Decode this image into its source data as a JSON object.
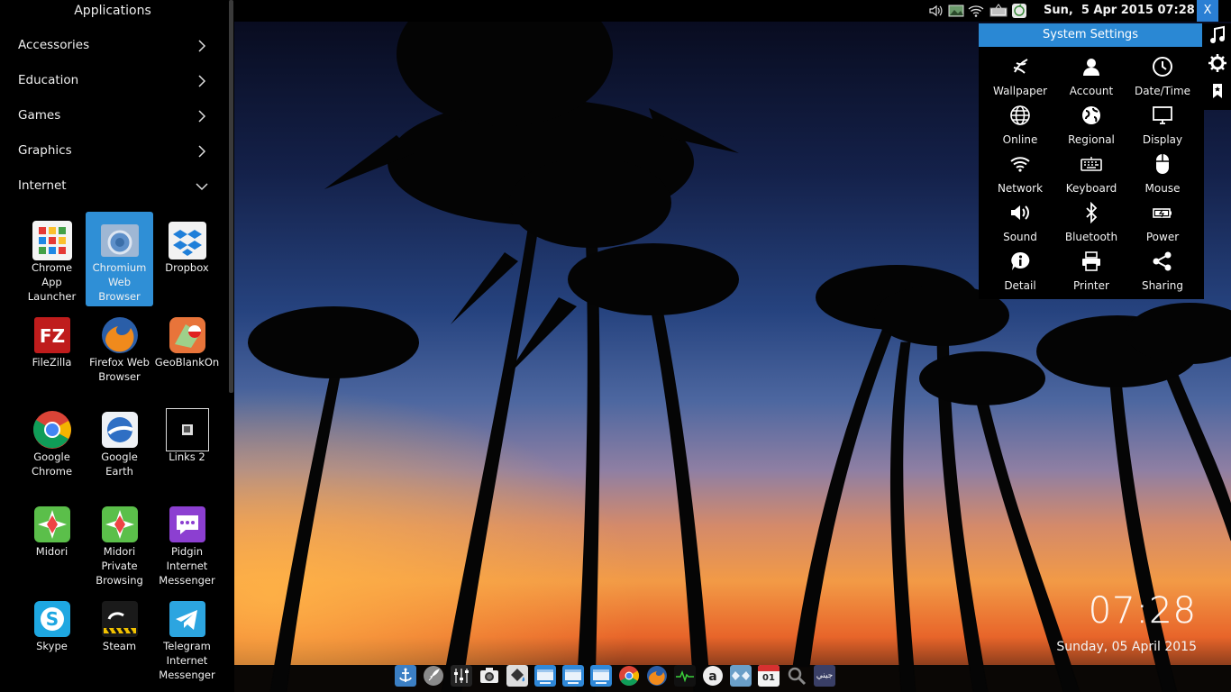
{
  "topbar": {
    "datetime": "Sun,  5 Apr 2015 07:28",
    "close_label": "X",
    "tray_icons": [
      "volume-icon",
      "image-viewer-icon",
      "wifi-icon",
      "keyboard-icon",
      "update-icon"
    ]
  },
  "appmenu": {
    "title": "Applications",
    "categories": [
      {
        "label": "Accessories",
        "expanded": false
      },
      {
        "label": "Education",
        "expanded": false
      },
      {
        "label": "Games",
        "expanded": false
      },
      {
        "label": "Graphics",
        "expanded": false
      },
      {
        "label": "Internet",
        "expanded": true
      }
    ],
    "apps": [
      {
        "label": "Chrome App Launcher",
        "lines": [
          "Chrome",
          "App",
          "Launcher"
        ],
        "icon": "chrome-app-launcher-icon",
        "selected": false
      },
      {
        "label": "Chromium Web Browser",
        "lines": [
          "Chromium",
          "Web",
          "Browser"
        ],
        "icon": "chromium-icon",
        "selected": true
      },
      {
        "label": "Dropbox",
        "lines": [
          "Dropbox"
        ],
        "icon": "dropbox-icon",
        "selected": false
      },
      {
        "label": "FileZilla",
        "lines": [
          "FileZilla"
        ],
        "icon": "filezilla-icon",
        "selected": false
      },
      {
        "label": "Firefox Web Browser",
        "lines": [
          "Firefox Web",
          "Browser"
        ],
        "icon": "firefox-icon",
        "selected": false
      },
      {
        "label": "GeoBlankOn",
        "lines": [
          "GeoBlankOn"
        ],
        "icon": "geoblankon-icon",
        "selected": false
      },
      {
        "label": "Google Chrome",
        "lines": [
          "Google",
          "Chrome"
        ],
        "icon": "google-chrome-icon",
        "selected": false
      },
      {
        "label": "Google Earth",
        "lines": [
          "Google",
          "Earth"
        ],
        "icon": "google-earth-icon",
        "selected": false
      },
      {
        "label": "Links 2",
        "lines": [
          "Links 2"
        ],
        "icon": "links2-icon",
        "selected": false
      },
      {
        "label": "Midori",
        "lines": [
          "Midori"
        ],
        "icon": "midori-icon",
        "selected": false
      },
      {
        "label": "Midori Private Browsing",
        "lines": [
          "Midori",
          "Private",
          "Browsing"
        ],
        "icon": "midori-private-icon",
        "selected": false
      },
      {
        "label": "Pidgin Internet Messenger",
        "lines": [
          "Pidgin",
          "Internet",
          "Messenger"
        ],
        "icon": "pidgin-icon",
        "selected": false
      },
      {
        "label": "Skype",
        "lines": [
          "Skype"
        ],
        "icon": "skype-icon",
        "selected": false
      },
      {
        "label": "Steam",
        "lines": [
          "Steam"
        ],
        "icon": "steam-icon",
        "selected": false
      },
      {
        "label": "Telegram Internet Messenger",
        "lines": [
          "Telegram",
          "Internet",
          "Messenger"
        ],
        "icon": "telegram-icon",
        "selected": false
      }
    ]
  },
  "settings": {
    "title": "System Settings",
    "items": [
      {
        "label": "Wallpaper",
        "icon": "wallpaper-icon"
      },
      {
        "label": "Account",
        "icon": "account-icon"
      },
      {
        "label": "Date/Time",
        "icon": "clock-icon"
      },
      {
        "label": "Online",
        "icon": "globe-icon"
      },
      {
        "label": "Regional",
        "icon": "regional-globe-icon"
      },
      {
        "label": "Display",
        "icon": "monitor-icon"
      },
      {
        "label": "Network",
        "icon": "wifi-icon"
      },
      {
        "label": "Keyboard",
        "icon": "keyboard-icon"
      },
      {
        "label": "Mouse",
        "icon": "mouse-icon"
      },
      {
        "label": "Sound",
        "icon": "speaker-icon"
      },
      {
        "label": "Bluetooth",
        "icon": "bluetooth-icon"
      },
      {
        "label": "Power",
        "icon": "battery-icon"
      },
      {
        "label": "Detail",
        "icon": "info-icon"
      },
      {
        "label": "Printer",
        "icon": "printer-icon"
      },
      {
        "label": "Sharing",
        "icon": "share-icon"
      }
    ],
    "side_icons": [
      "music-note-icon",
      "gear-icon",
      "bookmark-icon"
    ]
  },
  "desktop": {
    "time": "07:28",
    "date": "Sunday, 05 April 2015"
  },
  "dock": {
    "items": [
      "anchor-icon",
      "rocket-icon",
      "mixer-icon",
      "camera-icon",
      "paint-bucket-icon",
      "window-icon",
      "window-icon",
      "window-icon",
      "chrome-icon",
      "firefox-icon",
      "system-monitor-icon",
      "amazon-icon",
      "game-controller-icon",
      "calendar-icon",
      "magnifier-icon",
      "arabic-keyboard-icon"
    ],
    "calendar_day": "01",
    "arabic_label": "جيني"
  },
  "colors": {
    "accent": "#2a88d4",
    "selected_tile": "#2f8fd6",
    "panel_bg": "#000000"
  }
}
